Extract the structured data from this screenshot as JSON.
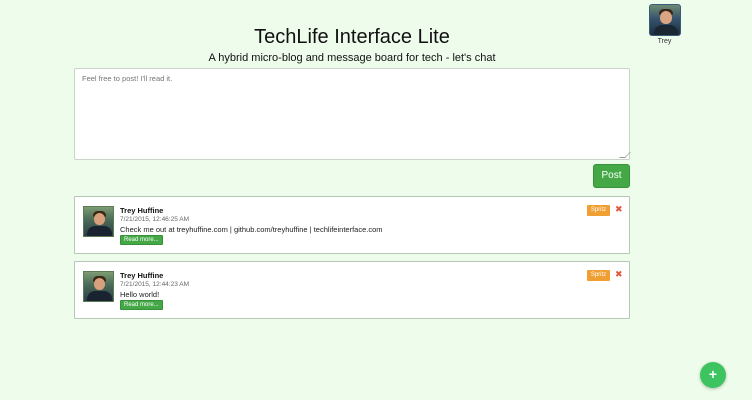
{
  "header": {
    "title": "TechLife Interface Lite",
    "subtitle": "A hybrid micro-blog and message board for tech - let's chat"
  },
  "user": {
    "name": "Trey"
  },
  "composer": {
    "placeholder": "Feel free to post! I'll read it.",
    "value": "",
    "post_label": "Post"
  },
  "posts": [
    {
      "author": "Trey Huffine",
      "timestamp": "7/21/2015, 12:46:25 AM",
      "text": "Check me out at treyhuffine.com | github.com/treyhuffine | techlifeinterface.com",
      "read_more_label": "Read more...",
      "spritz_label": "Spritz",
      "delete_icon": "close-icon"
    },
    {
      "author": "Trey Huffine",
      "timestamp": "7/21/2015, 12:44:23 AM",
      "text": "Hello world!",
      "read_more_label": "Read more...",
      "spritz_label": "Spritz",
      "delete_icon": "close-icon"
    }
  ],
  "fab": {
    "label": "+"
  },
  "colors": {
    "background": "#eefcec",
    "primary_green": "#43a845",
    "spritz_orange": "#f0a032",
    "delete_red": "#e2553e",
    "fab_green": "#3dc460"
  }
}
